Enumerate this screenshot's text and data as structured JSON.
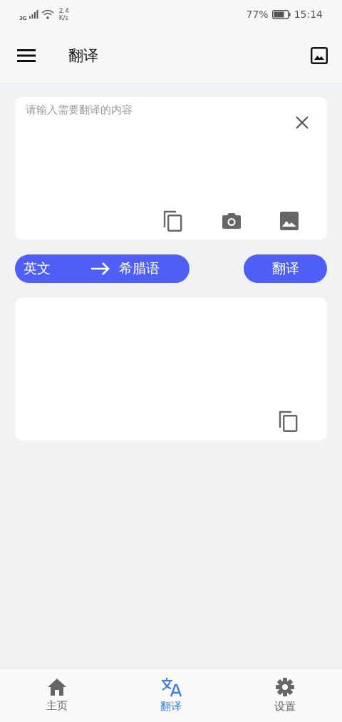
{
  "status_bar": {
    "network": "3G",
    "speed_value": "2.4",
    "speed_unit": "K/s",
    "battery": "77%",
    "time": "15:14"
  },
  "app_bar": {
    "title": "翻译"
  },
  "input": {
    "placeholder": "请输入需要翻译的内容"
  },
  "language": {
    "source": "英文",
    "target": "希腊语"
  },
  "translate_button": "翻译",
  "tabs": [
    {
      "label": "主页",
      "kind": "home",
      "selected": false
    },
    {
      "label": "翻译",
      "kind": "translate",
      "selected": true
    },
    {
      "label": "设置",
      "kind": "settings",
      "selected": false
    }
  ]
}
